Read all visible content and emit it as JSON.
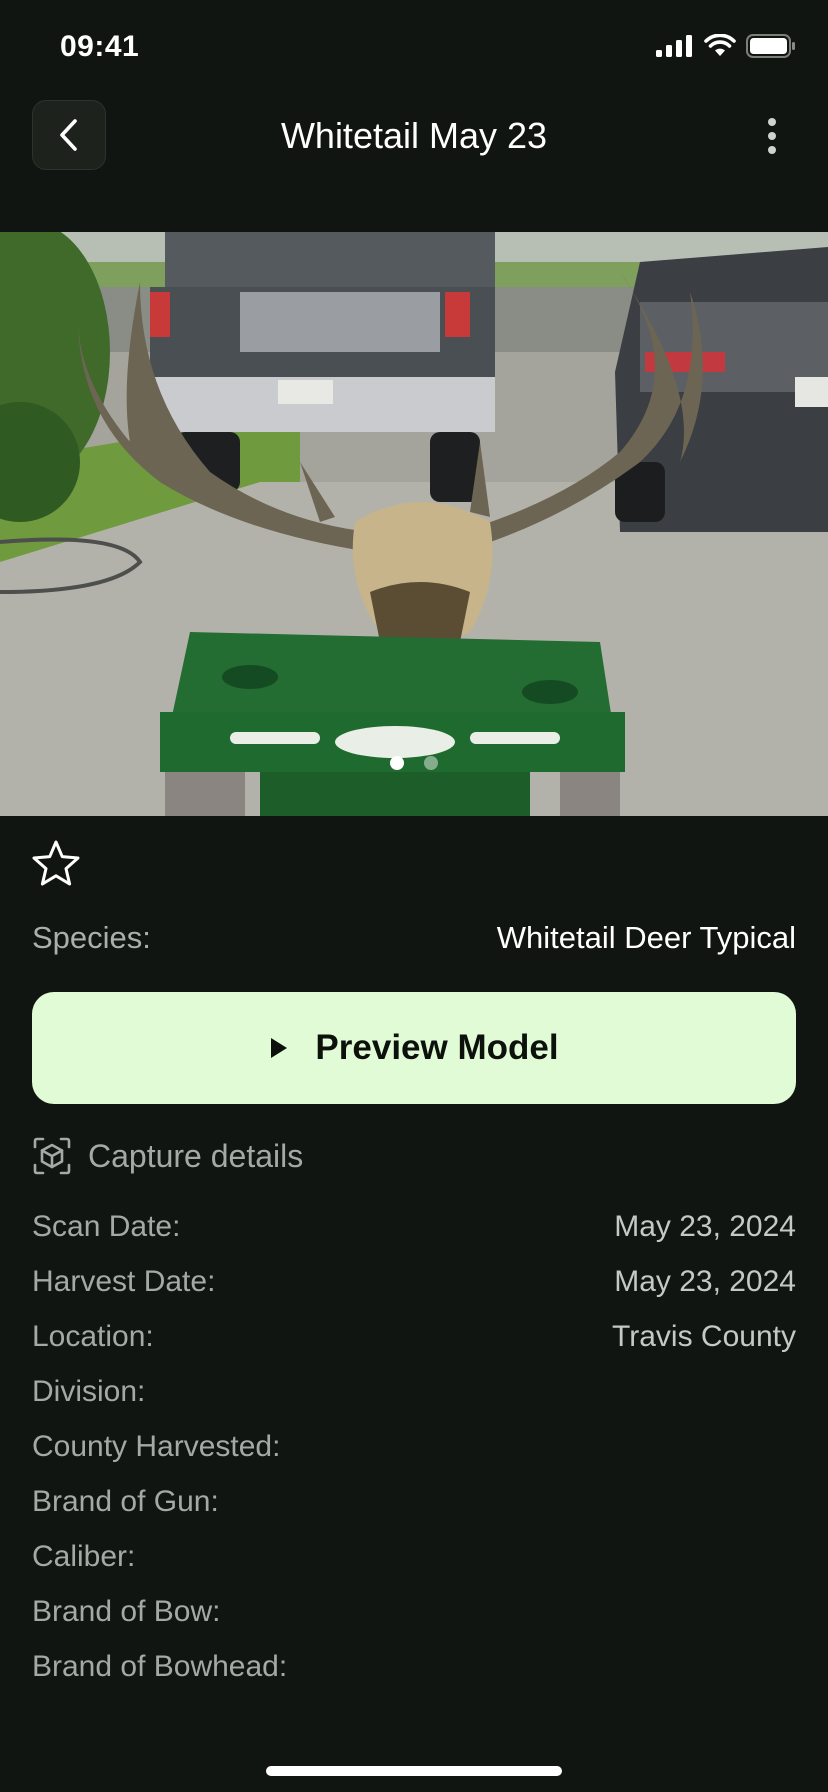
{
  "status_bar": {
    "time": "09:41"
  },
  "nav": {
    "title": "Whitetail May 23"
  },
  "gallery": {
    "page_count": 2,
    "current_page": 1
  },
  "species": {
    "label": "Species:",
    "value": "Whitetail Deer Typical"
  },
  "preview_button": {
    "label": "Preview Model"
  },
  "capture_section": {
    "title": "Capture details"
  },
  "details": [
    {
      "label": "Scan Date:",
      "value": "May 23, 2024"
    },
    {
      "label": "Harvest Date:",
      "value": "May 23, 2024"
    },
    {
      "label": "Location:",
      "value": "Travis County"
    },
    {
      "label": "Division:",
      "value": ""
    },
    {
      "label": "County Harvested:",
      "value": ""
    },
    {
      "label": "Brand of Gun:",
      "value": ""
    },
    {
      "label": "Caliber:",
      "value": ""
    },
    {
      "label": "Brand of Bow:",
      "value": ""
    },
    {
      "label": "Brand of Bowhead:",
      "value": ""
    }
  ],
  "colors": {
    "background": "#111511",
    "accent": "#e2fbd7",
    "muted_text": "#a3aaa3"
  },
  "icons": [
    "signal-icon",
    "wifi-icon",
    "battery-icon",
    "back-chevron-icon",
    "more-vertical-icon",
    "star-outline-icon",
    "play-icon",
    "cube-scan-icon"
  ]
}
